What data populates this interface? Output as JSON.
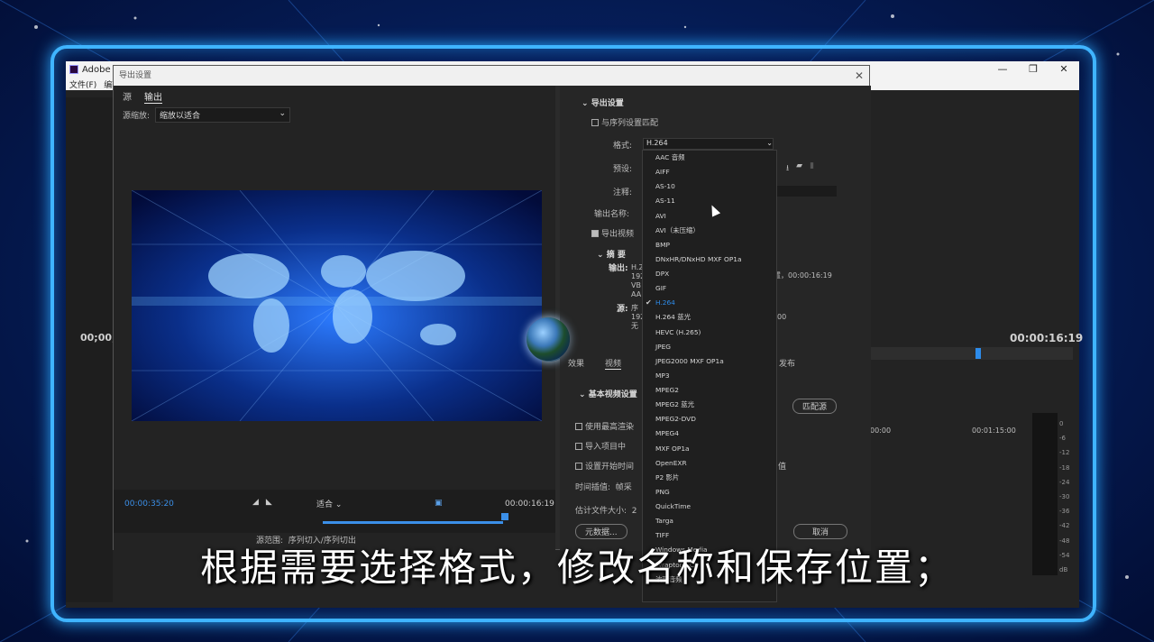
{
  "app": {
    "title": "Adobe P",
    "menu": [
      "文件(F)",
      "编辑"
    ],
    "window_controls": [
      "—",
      "❐",
      "✕"
    ],
    "left_timecode": "00;00;",
    "right_timecode": "00:00:16:19",
    "timeline_ticks": [
      "00:00",
      "00:01:15:00"
    ],
    "meter_labels": [
      "0",
      "-6",
      "-12",
      "-18",
      "-24",
      "-30",
      "-36",
      "-42",
      "-48",
      "-54",
      "dB"
    ]
  },
  "dialog": {
    "title": "导出设置",
    "close": "✕",
    "tabs": [
      "源",
      "输出"
    ],
    "source_scale_label": "源缩放:",
    "source_scale_value": "缩放以适合",
    "timecode_start": "00:00:35:20",
    "timecode_end": "00:00:16:19",
    "fit": "适合",
    "source_range_label": "源范围:",
    "source_range_value": "序列切入/序列切出"
  },
  "settings": {
    "section": "导出设置",
    "match_sequence": "与序列设置匹配",
    "format_label": "格式:",
    "format_value": "H.264",
    "preset_label": "预设:",
    "comment_label": "注释:",
    "output_name_label": "输出名称:",
    "export_video": "导出视频",
    "summary": "摘 要",
    "output_label": "输出:",
    "output_lines": [
      "H.2",
      "192",
      "VB",
      "AA"
    ],
    "output_time": "置，00:00:16:19",
    "source_label": "源:",
    "source_lines": [
      "序",
      "192",
      "无"
    ],
    "source_suffix": "00",
    "tabs": [
      "效果",
      "视频",
      "发布"
    ],
    "basic_video": "基本视频设置",
    "match_source": "匹配源",
    "use_max_render": "使用最高渲染",
    "import_project": "导入项目中",
    "set_start_time": "设置开始时间",
    "set_start_suffix": "值",
    "interp_label": "时间插值:",
    "interp_value": "帧采",
    "est_size": "估计文件大小:",
    "est_size_val": "2",
    "metadata_btn": "元数据...",
    "cancel_btn": "取消"
  },
  "format_options": [
    "AAC 音频",
    "AIFF",
    "AS-10",
    "AS-11",
    "AVI",
    "AVI（未压缩）",
    "BMP",
    "DNxHR/DNxHD MXF OP1a",
    "DPX",
    "GIF",
    "H.264",
    "H.264 蓝光",
    "HEVC (H.265)",
    "JPEG",
    "JPEG2000 MXF OP1a",
    "MP3",
    "MPEG2",
    "MPEG2 蓝光",
    "MPEG2-DVD",
    "MPEG4",
    "MXF OP1a",
    "OpenEXR",
    "P2 影片",
    "PNG",
    "QuickTime",
    "Targa",
    "TIFF",
    "Windows Media",
    "Wraptor DCP",
    "波形音频"
  ],
  "selected_format_index": 10,
  "subtitle": "根据需要选择格式，修改名称和保存位置；"
}
